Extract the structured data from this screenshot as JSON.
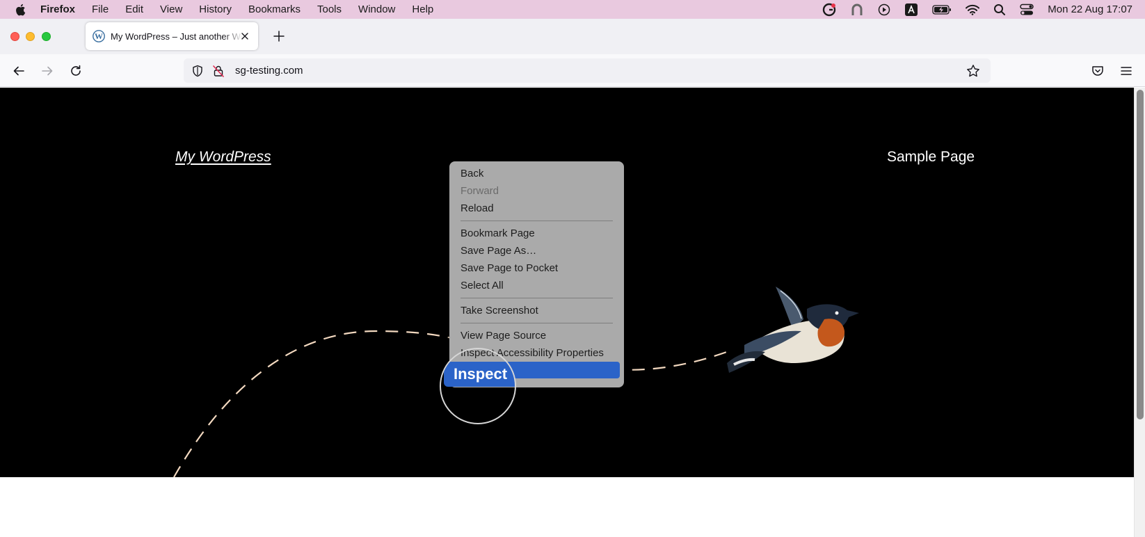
{
  "menubar": {
    "app": "Firefox",
    "items": [
      "File",
      "Edit",
      "View",
      "History",
      "Bookmarks",
      "Tools",
      "Window",
      "Help"
    ],
    "clock": "Mon 22 Aug  17:07"
  },
  "tab": {
    "title": "My WordPress – Just another WordPress site"
  },
  "navbar": {
    "url": "sg-testing.com"
  },
  "site": {
    "title": "My WordPress",
    "nav_link": "Sample Page"
  },
  "context_menu": {
    "items": [
      {
        "label": "Back"
      },
      {
        "label": "Forward"
      },
      {
        "label": "Reload"
      },
      {
        "label": "Bookmark Page"
      },
      {
        "label": "Save Page As…"
      },
      {
        "label": "Save Page to Pocket"
      },
      {
        "label": "Select All"
      },
      {
        "label": "Take Screenshot"
      },
      {
        "label": "View Page Source"
      },
      {
        "label": "Inspect Accessibility Properties"
      },
      {
        "label": "Inspect"
      }
    ]
  },
  "magnifier": {
    "label": "Inspect"
  },
  "colors": {
    "menubar_bg": "#e9c9df",
    "selection": "#2b63c8",
    "page_bg": "#000000",
    "curve": "#f3d9c0"
  }
}
